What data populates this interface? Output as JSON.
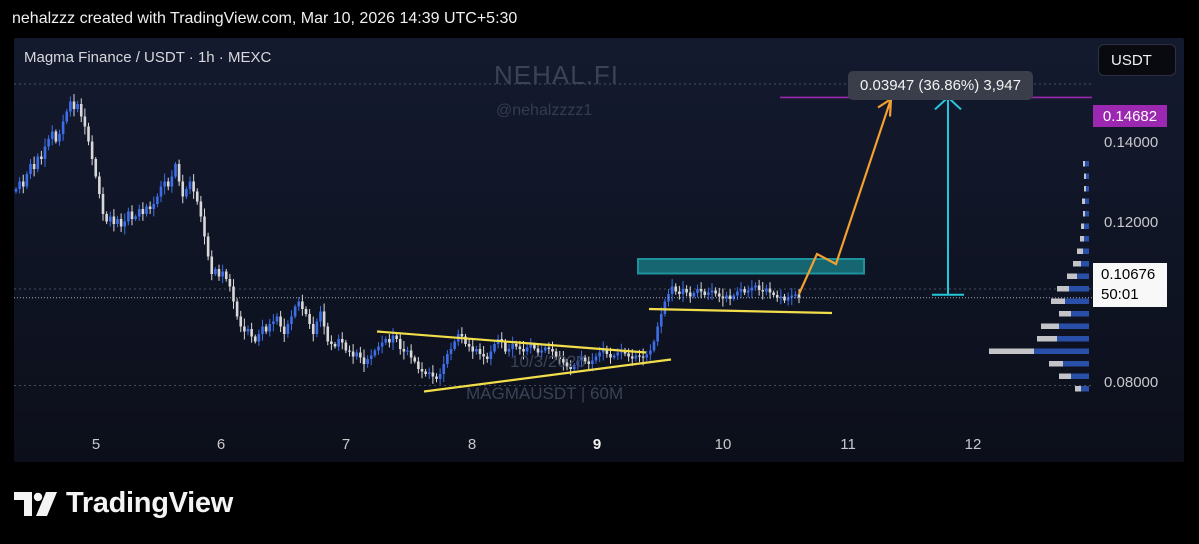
{
  "caption": "nehalzzz created with TradingView.com, Mar 10, 2026 14:39 UTC+5:30",
  "symbol": "Magma Finance / USDT · 1h · MEXC",
  "currency_button": "USDT",
  "watermark": {
    "title": "NEHAL.FI",
    "handle": "@nehalzzzz1",
    "date": "10/3/2026",
    "pair": "MAGMAUSDT | 60M"
  },
  "measure_label": "0.03947 (36.86%) 3,947",
  "target_badge": "0.14682",
  "current_badge": {
    "price": "0.10676",
    "countdown": "50:01"
  },
  "brand": "TradingView",
  "colors": {
    "bull": "#3d6ee8",
    "bear": "#d8d8d8",
    "triangle": "#f2de4a",
    "resistance": "#1fa0a8",
    "projection": "#f0a030",
    "measure": "#26c6da",
    "target": "#9c27b0"
  },
  "chart_data": {
    "type": "candlestick",
    "title": "Magma Finance / USDT · 1h · MEXC",
    "x_ticks": [
      "5",
      "6",
      "7",
      "8",
      "9",
      "10",
      "11",
      "12"
    ],
    "y_ticks": [
      "0.14000",
      "0.12000",
      "0.08000"
    ],
    "ylim": [
      0.0755,
      0.1535
    ],
    "last_price": 0.10676,
    "target_price": 0.14682,
    "measured_move": {
      "change": 0.03947,
      "percent": 36.86,
      "ticks": 3947
    },
    "closes": [
      0.1285,
      0.13,
      0.129,
      0.1315,
      0.1335,
      0.1325,
      0.135,
      0.1345,
      0.137,
      0.1385,
      0.14,
      0.138,
      0.1395,
      0.142,
      0.144,
      0.146,
      0.1445,
      0.1455,
      0.143,
      0.141,
      0.138,
      0.1345,
      0.131,
      0.1275,
      0.1235,
      0.122,
      0.123,
      0.1215,
      0.1225,
      0.121,
      0.122,
      0.124,
      0.1225,
      0.123,
      0.1245,
      0.1235,
      0.125,
      0.1245,
      0.1255,
      0.127,
      0.129,
      0.13,
      0.129,
      0.131,
      0.1335,
      0.13,
      0.127,
      0.1285,
      0.13,
      0.128,
      0.126,
      0.123,
      0.119,
      0.115,
      0.1115,
      0.1125,
      0.111,
      0.112,
      0.1105,
      0.109,
      0.106,
      0.103,
      0.101,
      0.1,
      0.1005,
      0.099,
      0.098,
      0.0995,
      0.101,
      0.1,
      0.1015,
      0.102,
      0.103,
      0.101,
      0.0995,
      0.1015,
      0.103,
      0.105,
      0.106,
      0.1045,
      0.1035,
      0.1015,
      0.0995,
      0.102,
      0.104,
      0.101,
      0.098,
      0.0975,
      0.097,
      0.0985,
      0.0978,
      0.0962,
      0.096,
      0.095,
      0.0958,
      0.0948,
      0.0935,
      0.0945,
      0.0952,
      0.0962,
      0.097,
      0.0978,
      0.0985,
      0.0978,
      0.0992,
      0.0985,
      0.0965,
      0.096,
      0.0962,
      0.0948,
      0.094,
      0.0925,
      0.092,
      0.0915,
      0.0918,
      0.091,
      0.0905,
      0.0915,
      0.0935,
      0.0955,
      0.0965,
      0.098,
      0.0995,
      0.099,
      0.0975,
      0.097,
      0.096,
      0.0965,
      0.0955,
      0.095,
      0.0945,
      0.096,
      0.0975,
      0.0985,
      0.098,
      0.096,
      0.0965,
      0.0975,
      0.097,
      0.0965,
      0.096,
      0.0968,
      0.0974,
      0.0966,
      0.0958,
      0.0962,
      0.0968,
      0.0965,
      0.096,
      0.095,
      0.0945,
      0.0938,
      0.093,
      0.0925,
      0.0933,
      0.0942,
      0.0948,
      0.094,
      0.0935,
      0.0942,
      0.095,
      0.0958,
      0.0964,
      0.0955,
      0.0948,
      0.0952,
      0.0958,
      0.0962,
      0.0956,
      0.095,
      0.0946,
      0.0952,
      0.095,
      0.0948,
      0.0954,
      0.0962,
      0.098,
      0.101,
      0.1035,
      0.106,
      0.1075,
      0.109,
      0.108,
      0.1075,
      0.1085,
      0.1078,
      0.107,
      0.1077,
      0.1085,
      0.108,
      0.1073,
      0.1078,
      0.1082,
      0.1076,
      0.107,
      0.1066,
      0.1072,
      0.1065,
      0.1072,
      0.108,
      0.1085,
      0.1078,
      0.1082,
      0.1088,
      0.1092,
      0.1083,
      0.108,
      0.1086,
      0.1078,
      0.1073,
      0.1068,
      0.107,
      0.1062,
      0.1068,
      0.1072,
      0.1074,
      0.1068
    ]
  }
}
